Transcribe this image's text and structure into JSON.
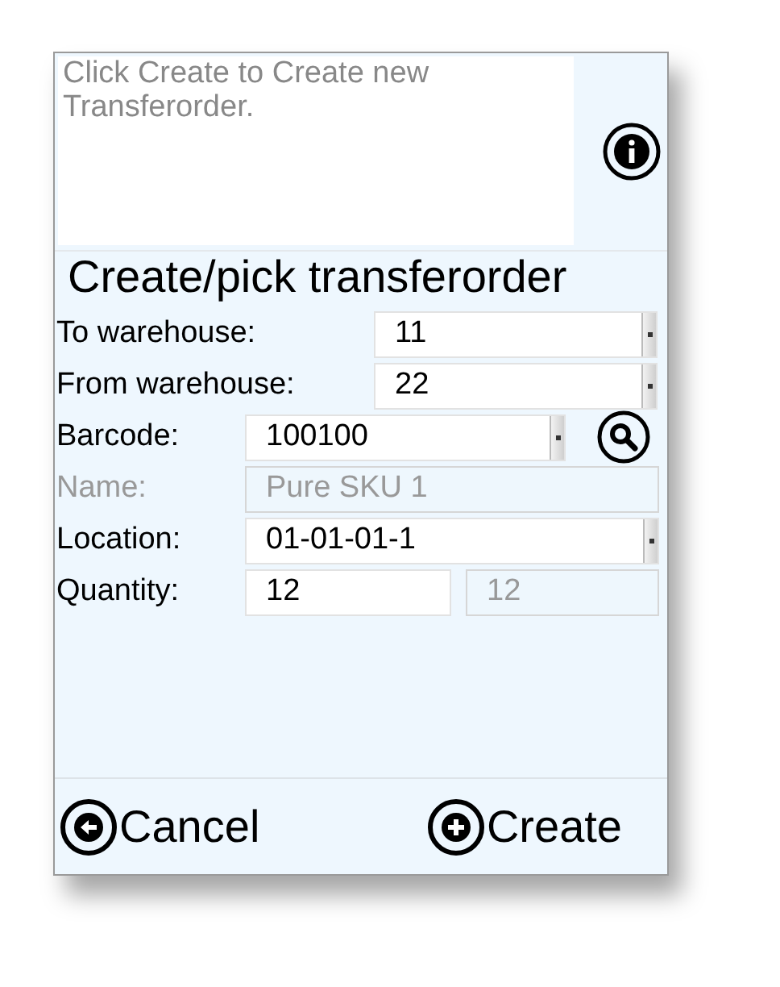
{
  "message": {
    "placeholder": "Click Create to Create new Transferorder."
  },
  "title": "Create/pick transferorder",
  "fields": [
    {
      "label": "To warehouse:",
      "kind": "select",
      "value": "11",
      "disabled": false
    },
    {
      "label": "From warehouse:",
      "kind": "select",
      "value": "22",
      "disabled": false
    },
    {
      "label": "Barcode:",
      "kind": "search_select",
      "value": "100100",
      "disabled": false
    },
    {
      "label": "Name:",
      "kind": "text",
      "value": "Pure SKU 1",
      "disabled": true
    },
    {
      "label": "Location:",
      "kind": "select",
      "value": "01-01-01-1",
      "disabled": false
    },
    {
      "label": "Quantity:",
      "kind": "pair",
      "value": "12",
      "disabled": false,
      "second_value": "12"
    }
  ],
  "buttons": [
    {
      "label": "Cancel",
      "kind": "back"
    },
    {
      "label": "Create",
      "kind": "add"
    }
  ]
}
